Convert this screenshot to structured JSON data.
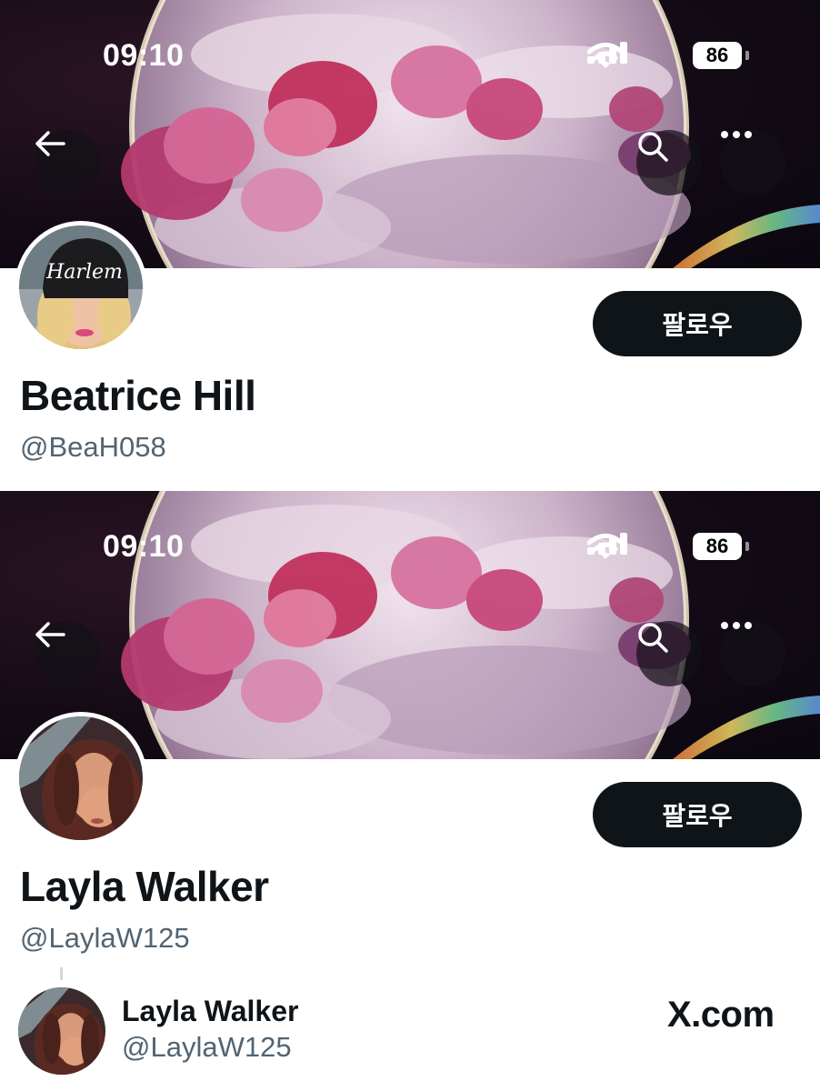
{
  "profiles": [
    {
      "status_time": "09:10",
      "battery": "86",
      "follow_label": "팔로우",
      "display_name": "Beatrice Hill",
      "handle": "@BeaH058",
      "avatar_text": "Harlem"
    },
    {
      "status_time": "09:10",
      "battery": "86",
      "follow_label": "팔로우",
      "display_name": "Layla Walker",
      "handle": "@LaylaW125"
    }
  ],
  "footer": {
    "name": "Layla Walker",
    "handle": "@LaylaW125",
    "site": "X.com"
  },
  "icons": [
    "back-arrow-icon",
    "search-icon",
    "more-icon",
    "signal-icon",
    "wifi-icon",
    "battery-icon"
  ],
  "colors": {
    "button_bg": "#0f1419",
    "handle_text": "#536471"
  }
}
